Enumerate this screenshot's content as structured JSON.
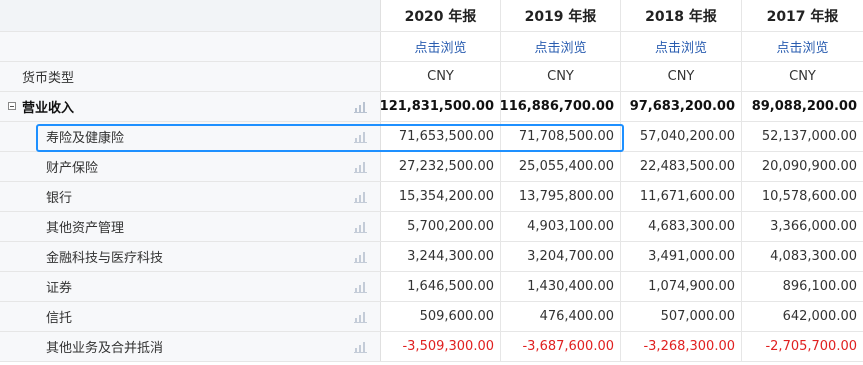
{
  "header": {
    "years": [
      "2020 年报",
      "2019 年报",
      "2018 年报",
      "2017 年报"
    ]
  },
  "browse": {
    "link_label": "点击浏览"
  },
  "currency": {
    "label": "货币类型",
    "values": [
      "CNY",
      "CNY",
      "CNY",
      "CNY"
    ]
  },
  "revenue": {
    "label": "营业收入",
    "values": [
      "121,831,500.00",
      "116,886,700.00",
      "97,683,200.00",
      "89,088,200.00"
    ]
  },
  "segments": [
    {
      "label": "寿险及健康险",
      "values": [
        "71,653,500.00",
        "71,708,500.00",
        "57,040,200.00",
        "52,137,000.00"
      ]
    },
    {
      "label": "财产保险",
      "values": [
        "27,232,500.00",
        "25,055,400.00",
        "22,483,500.00",
        "20,090,900.00"
      ]
    },
    {
      "label": "银行",
      "values": [
        "15,354,200.00",
        "13,795,800.00",
        "11,671,600.00",
        "10,578,600.00"
      ]
    },
    {
      "label": "其他资产管理",
      "values": [
        "5,700,200.00",
        "4,903,100.00",
        "4,683,300.00",
        "3,366,000.00"
      ]
    },
    {
      "label": "金融科技与医疗科技",
      "values": [
        "3,244,300.00",
        "3,204,700.00",
        "3,491,000.00",
        "4,083,300.00"
      ]
    },
    {
      "label": "证券",
      "values": [
        "1,646,500.00",
        "1,430,400.00",
        "1,074,900.00",
        "896,100.00"
      ]
    },
    {
      "label": "信托",
      "values": [
        "509,600.00",
        "476,400.00",
        "507,000.00",
        "642,000.00"
      ]
    },
    {
      "label": "其他业务及合并抵消",
      "values": [
        "-3,509,300.00",
        "-3,687,600.00",
        "-3,268,300.00",
        "-2,705,700.00"
      ]
    }
  ],
  "icons": {
    "row_chart": "bar-chart-icon",
    "collapse": "collapse-minus-icon"
  },
  "colors": {
    "link": "#2a5db0",
    "negative": "#e02020",
    "highlight": "#1e90ff"
  }
}
